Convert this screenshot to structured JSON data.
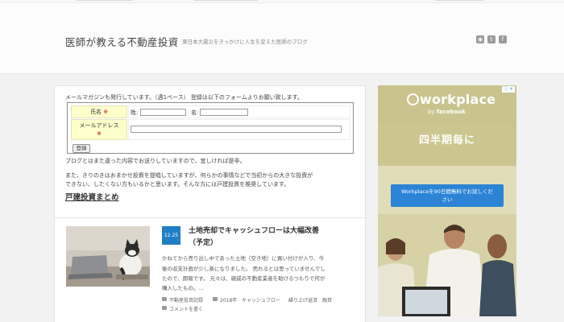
{
  "header": {
    "site_title": "医師が教える不動産投資",
    "site_description": "東日本大震災をきっかけに人生を変えた医師のブログ",
    "social_icons": [
      "rss-icon",
      "twitter-icon",
      "facebook-icon"
    ]
  },
  "mail_section": {
    "intro": "メールマガジンも発行しています。（週1ペース） 登録は以下のフォームよりお願い致します。",
    "form": {
      "name_label": "氏名",
      "required_mark": "※",
      "last_name_label": "姓:",
      "first_name_label": "名:",
      "email_label": "メールアドレス",
      "submit_label": "登録"
    },
    "para1": "ブログとはまた違った内容でお送りしていますので、宜しければ是非。",
    "para2": "また、きりのきはおまかせ投資を提唱していますが、何らかの事情などで当初からの大きな投資が",
    "para3": "できない、したくない方もいるかと思います。そんな方には戸建投資を推奨しています。",
    "link_title": "戸建投資まとめ"
  },
  "article": {
    "date": "12.25",
    "title_line1": "土地売却でキャッシュフローは大幅改善",
    "title_line2": "（予定）",
    "excerpt_lines": [
      "かねてから売り出し中であった土地（空き地）に買い付けが入り、今",
      "後の収支計画が少し楽になりました。 売れるとは思っていませんでし",
      "たので、朗報です。 元々は、親戚の不動産業者を助けるつもりで何が",
      "購入したもの。..."
    ],
    "category": "不動産投資記録",
    "tags": [
      "2018年",
      "キャッシュフロー",
      "繰り上げ返済",
      "融資"
    ],
    "comment_link": "コメントを書く"
  },
  "ad": {
    "ad_choice": "ⓘ ✕",
    "brand": "workplace",
    "by_text": "by",
    "by_brand": "facebook",
    "headline": "四半期毎に",
    "cta_line1": "Workplaceを90日間無料でお試しくだ",
    "cta_line2": "さい"
  },
  "colors": {
    "accent_blue": "#1f7fc4",
    "ad_background": "#c6c28d",
    "form_label_bg": "#ffffcc"
  }
}
